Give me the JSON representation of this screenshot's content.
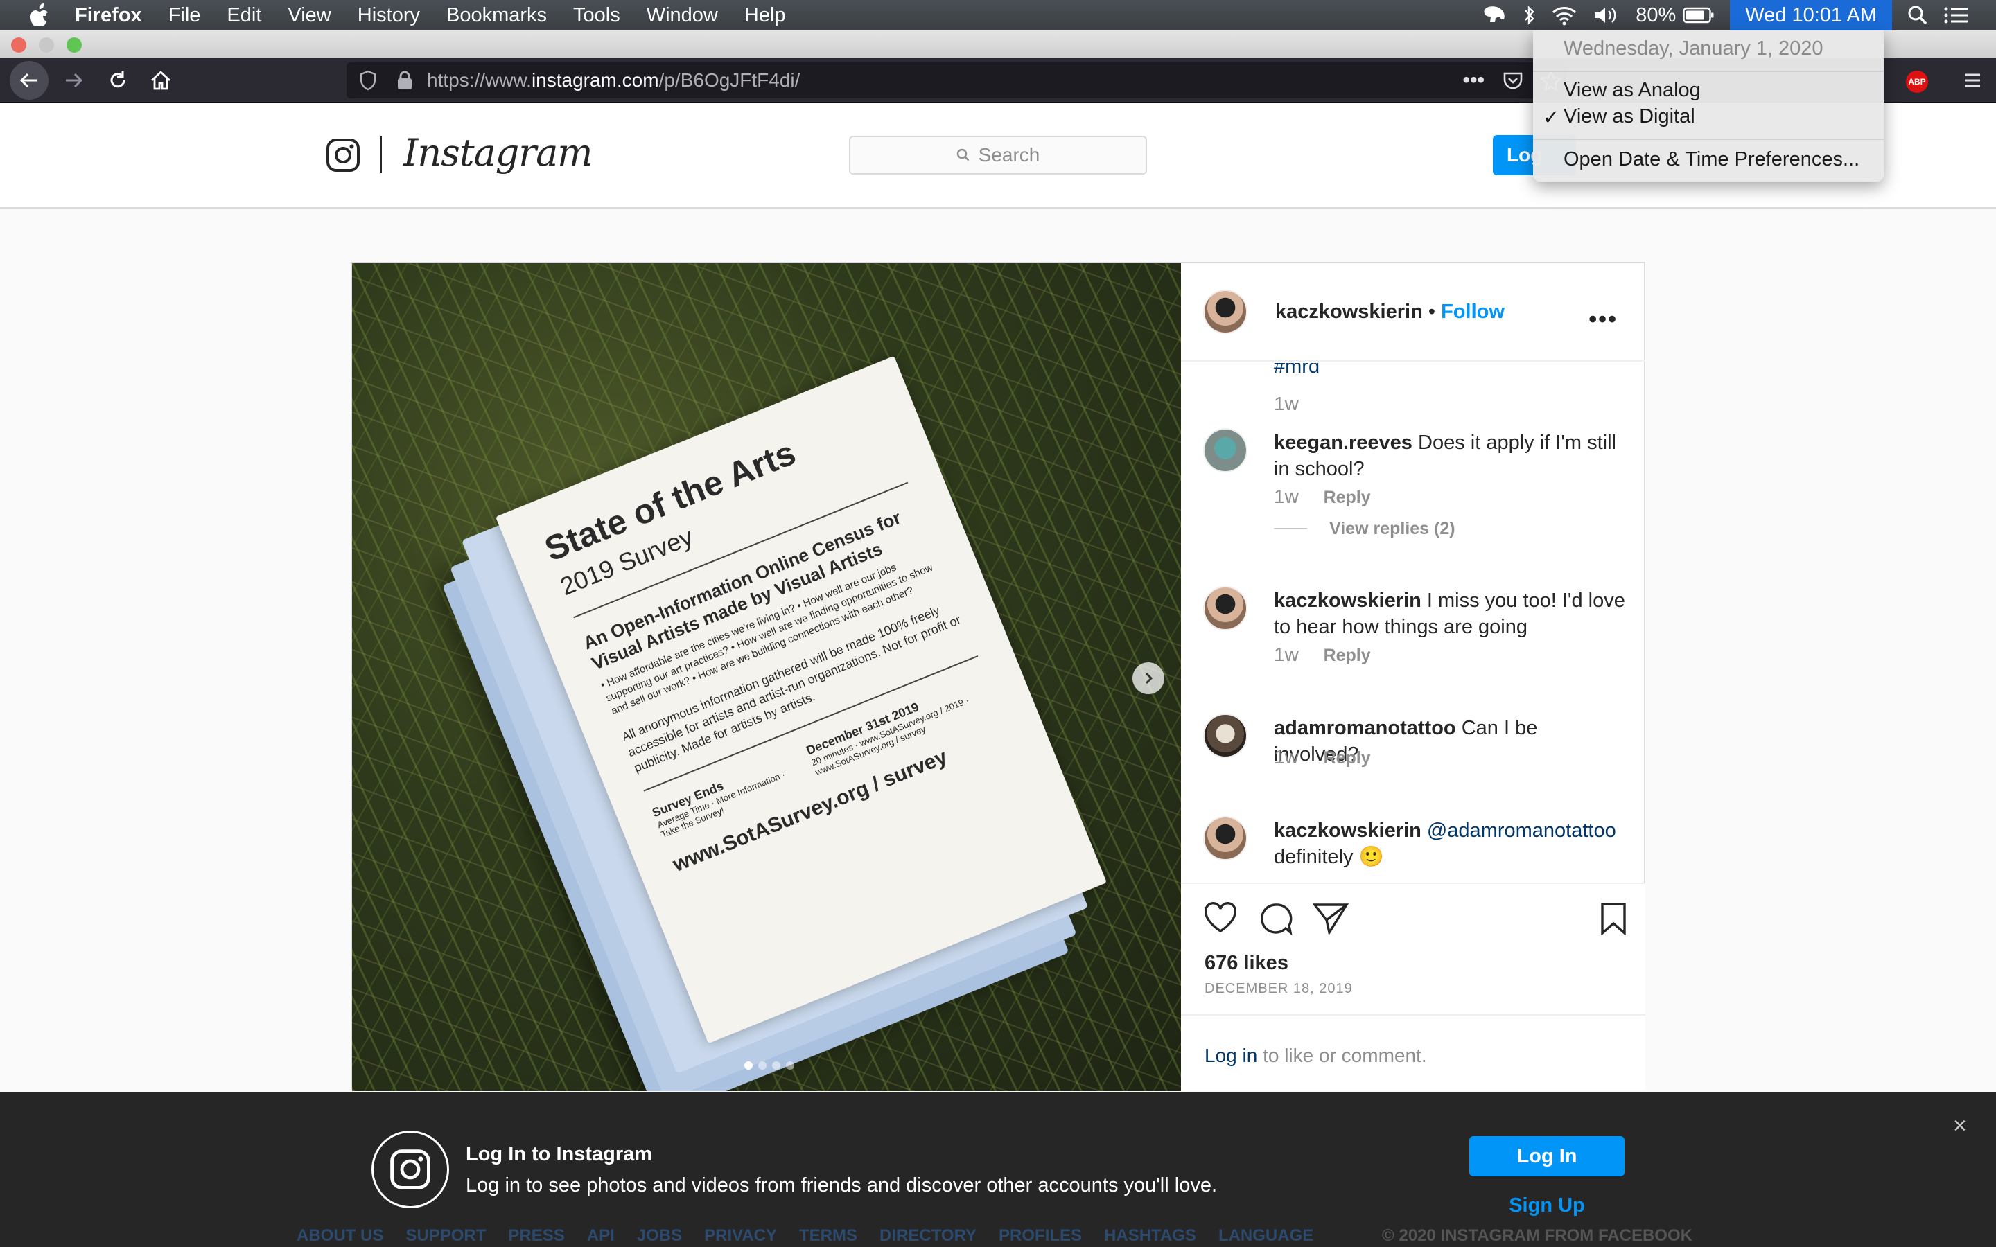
{
  "menubar": {
    "app_name": "Firefox",
    "menus": [
      "File",
      "Edit",
      "View",
      "History",
      "Bookmarks",
      "Tools",
      "Window",
      "Help"
    ],
    "battery": "80%",
    "clock": "Wed 10:01 AM"
  },
  "browser": {
    "url_prefix": "https://www.",
    "url_domain": "instagram.com",
    "url_path": "/p/B6OgJFtF4di/",
    "abp_label": "ABP"
  },
  "date_menu": {
    "date": "Wednesday, January 1, 2020",
    "analog": "View as Analog",
    "digital": "View as Digital",
    "check": "✓",
    "preferences": "Open Date & Time Preferences..."
  },
  "ig_header": {
    "wordmark": "Instagram",
    "search_placeholder": "Search",
    "login_label": "Log"
  },
  "photo": {
    "title": "State of the Arts",
    "subtitle": "2019 Survey",
    "heading": "An Open-Information Online Census for Visual Artists made by Visual Artists",
    "bullets": "• How affordable are the cities we're living in? • How well are our jobs supporting our art practices? • How well are we finding opportunities to show and sell our work? • How are we building connections with each other?",
    "body": "All anonymous information gathered will be made 100% freely accessible for artists and artist-run organizations. Not for profit or publicity. Made for artists by artists.",
    "ends_label": "Survey Ends",
    "ends_details": "Average Time · More Information · Take the Survey!",
    "ends_date": "December 31st 2019",
    "ends_info": "20 minutes · www.SotASurvey.org / 2019 · www.SotASurvey.org / survey",
    "url": "www.SotASurvey.org / survey"
  },
  "post": {
    "author": "kaczkowskierin",
    "follow": "Follow",
    "more": "•••",
    "partial_tag": "#mrd",
    "partial_time": "1w",
    "comments": [
      {
        "user": "keegan.reeves",
        "text": "Does it apply if I'm still in school?",
        "time": "1w",
        "reply": "Reply",
        "view_replies": "View replies (2)"
      },
      {
        "user": "kaczkowskierin",
        "text": "I miss you too! I'd love to hear how things are going",
        "time": "1w",
        "reply": "Reply"
      },
      {
        "user": "adamromanotattoo",
        "text": "Can I be involved?",
        "time": "1w",
        "reply": "Reply"
      },
      {
        "user": "kaczkowskierin",
        "mention": "@adamromanotattoo",
        "text": "definitely 🙂"
      }
    ],
    "likes": "676 likes",
    "date": "DECEMBER 18, 2019",
    "login_link": "Log in",
    "login_rest": " to like or comment."
  },
  "banner": {
    "title": "Log In to Instagram",
    "text": "Log in to see photos and videos from friends and discover other accounts you'll love.",
    "login": "Log In",
    "signup": "Sign Up",
    "close": "×"
  },
  "footer": {
    "links": [
      "ABOUT US",
      "SUPPORT",
      "PRESS",
      "API",
      "JOBS",
      "PRIVACY",
      "TERMS",
      "DIRECTORY",
      "PROFILES",
      "HASHTAGS",
      "LANGUAGE"
    ],
    "copyright": "© 2020 INSTAGRAM FROM FACEBOOK"
  }
}
